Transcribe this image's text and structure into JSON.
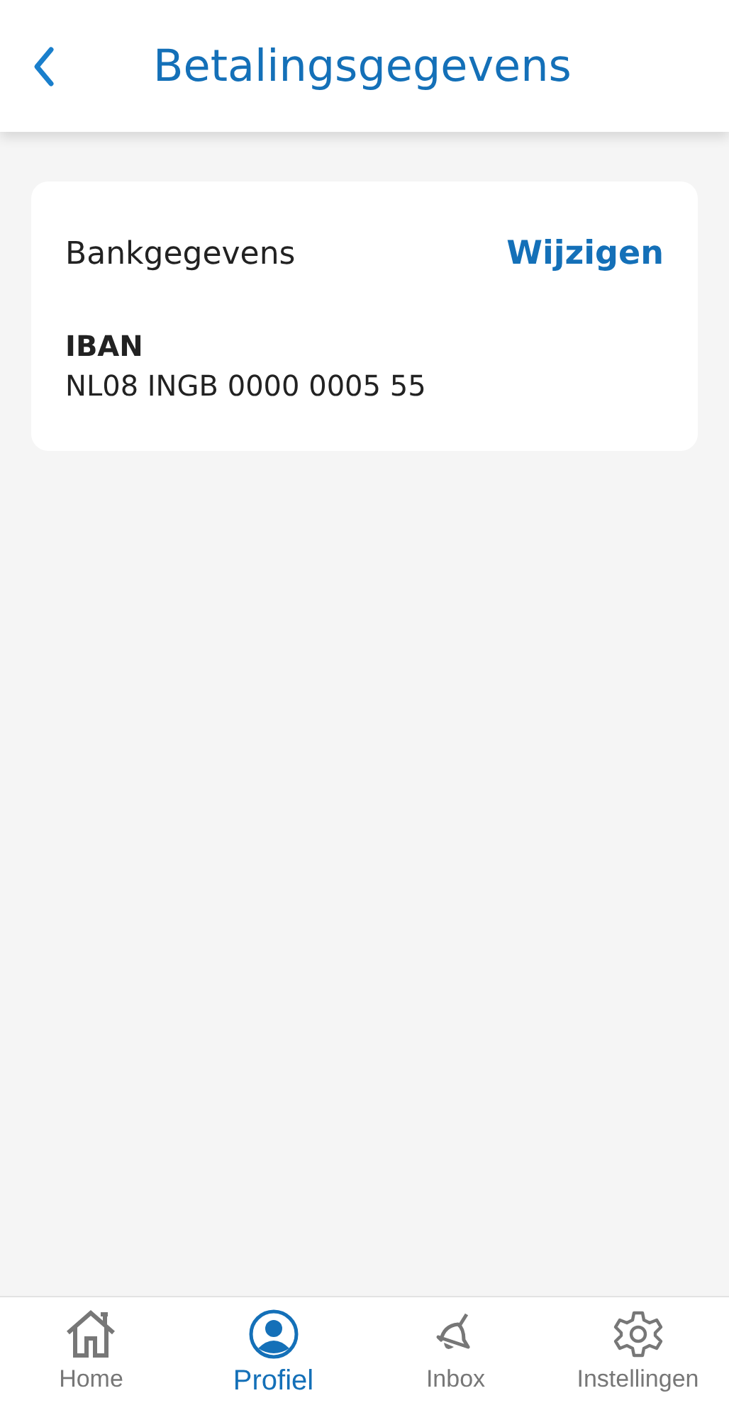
{
  "header": {
    "title": "Betalingsgegevens"
  },
  "card": {
    "title": "Bankgegevens",
    "action": "Wijzigen",
    "field_label": "IBAN",
    "field_value": "NL08 INGB 0000 0005 55"
  },
  "tab_bar": [
    {
      "kind": "home",
      "label": "Home",
      "selected": false
    },
    {
      "kind": "profile",
      "label": "Profiel",
      "selected": true
    },
    {
      "kind": "bell",
      "label": "Inbox",
      "selected": false
    },
    {
      "kind": "gear",
      "label": "Instellingen",
      "selected": false
    }
  ]
}
